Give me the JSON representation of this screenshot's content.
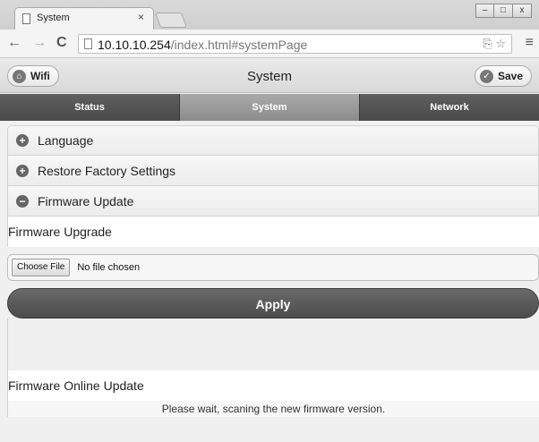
{
  "browser": {
    "tab_title": "System",
    "tab_close": "×",
    "window_controls": [
      "–",
      "□",
      "x"
    ],
    "nav": {
      "back": "←",
      "forward": "→",
      "reload": "C"
    },
    "url_main": "10.10.10.254",
    "url_rest": "/index.html#systemPage",
    "omni_icons": "⎘ ☆",
    "menu": "≡"
  },
  "header": {
    "title": "System",
    "left_button": "Wifi",
    "left_icon": "home-icon",
    "right_button": "Save",
    "right_icon": "check-icon"
  },
  "tabs": [
    {
      "label": "Status",
      "active": false
    },
    {
      "label": "System",
      "active": true
    },
    {
      "label": "Network",
      "active": false
    }
  ],
  "sections": [
    {
      "label": "Language",
      "state": "collapsed",
      "icon": "plus-icon",
      "glyph": "+"
    },
    {
      "label": "Restore Factory Settings",
      "state": "collapsed",
      "icon": "plus-icon",
      "glyph": "+"
    },
    {
      "label": "Firmware Update",
      "state": "expanded",
      "icon": "minus-icon",
      "glyph": "−"
    }
  ],
  "firmware": {
    "upgrade_title": "Firmware Upgrade",
    "choose_file": "Choose File",
    "no_file": "No file chosen",
    "apply": "Apply",
    "online_title": "Firmware Online Update",
    "online_status": "Please wait, scaning the new firmware version."
  }
}
